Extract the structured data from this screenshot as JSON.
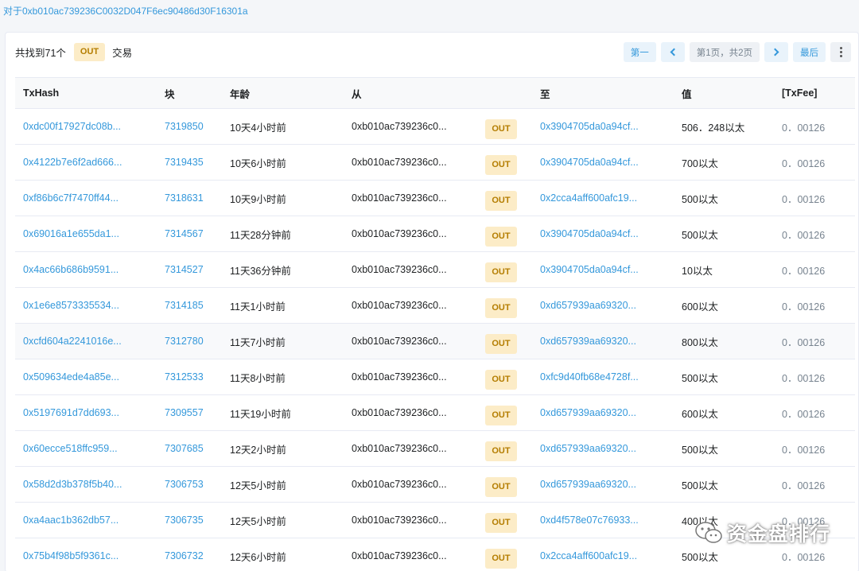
{
  "filter_text": "对于0xb010ac739236C0032D047F6ec90486d30F16301a",
  "summary": {
    "prefix": "共找到71个",
    "badge": "OUT",
    "suffix": "交易"
  },
  "pager": {
    "first": "第一",
    "info": "第1页，共2页",
    "last": "最后"
  },
  "columns": [
    "TxHash",
    "块",
    "年龄",
    "从",
    "",
    "至",
    "值",
    "[TxFee]"
  ],
  "rows": [
    {
      "hash": "0xdc00f17927dc08b...",
      "block": "7319850",
      "age": "10天4小时前",
      "from": "0xb010ac739236c0...",
      "dir": "OUT",
      "to": "0x3904705da0a94cf...",
      "value": "506．248以太",
      "fee": "0．00126"
    },
    {
      "hash": "0x4122b7e6f2ad666...",
      "block": "7319435",
      "age": "10天6小时前",
      "from": "0xb010ac739236c0...",
      "dir": "OUT",
      "to": "0x3904705da0a94cf...",
      "value": "700以太",
      "fee": "0．00126"
    },
    {
      "hash": "0xf86b6c7f7470ff44...",
      "block": "7318631",
      "age": "10天9小时前",
      "from": "0xb010ac739236c0...",
      "dir": "OUT",
      "to": "0x2cca4aff600afc19...",
      "value": "500以太",
      "fee": "0．00126"
    },
    {
      "hash": "0x69016a1e655da1...",
      "block": "7314567",
      "age": "11天28分钟前",
      "from": "0xb010ac739236c0...",
      "dir": "OUT",
      "to": "0x3904705da0a94cf...",
      "value": "500以太",
      "fee": "0．00126"
    },
    {
      "hash": "0x4ac66b686b9591...",
      "block": "7314527",
      "age": "11天36分钟前",
      "from": "0xb010ac739236c0...",
      "dir": "OUT",
      "to": "0x3904705da0a94cf...",
      "value": "10以太",
      "fee": "0．00126"
    },
    {
      "hash": "0x1e6e8573335534...",
      "block": "7314185",
      "age": "11天1小时前",
      "from": "0xb010ac739236c0...",
      "dir": "OUT",
      "to": "0xd657939aa69320...",
      "value": "600以太",
      "fee": "0．00126"
    },
    {
      "hash": "0xcfd604a2241016e...",
      "block": "7312780",
      "age": "11天7小时前",
      "from": "0xb010ac739236c0...",
      "dir": "OUT",
      "to": "0xd657939aa69320...",
      "value": "800以太",
      "fee": "0．00126"
    },
    {
      "hash": "0x509634ede4a85e...",
      "block": "7312533",
      "age": "11天8小时前",
      "from": "0xb010ac739236c0...",
      "dir": "OUT",
      "to": "0xfc9d40fb68e4728f...",
      "value": "500以太",
      "fee": "0．00126"
    },
    {
      "hash": "0x5197691d7dd693...",
      "block": "7309557",
      "age": "11天19小时前",
      "from": "0xb010ac739236c0...",
      "dir": "OUT",
      "to": "0xd657939aa69320...",
      "value": "600以太",
      "fee": "0．00126"
    },
    {
      "hash": "0x60ecce518ffc959...",
      "block": "7307685",
      "age": "12天2小时前",
      "from": "0xb010ac739236c0...",
      "dir": "OUT",
      "to": "0xd657939aa69320...",
      "value": "500以太",
      "fee": "0．00126"
    },
    {
      "hash": "0x58d2d3b378f5b40...",
      "block": "7306753",
      "age": "12天5小时前",
      "from": "0xb010ac739236c0...",
      "dir": "OUT",
      "to": "0xd657939aa69320...",
      "value": "500以太",
      "fee": "0．00126"
    },
    {
      "hash": "0xa4aac1b362db57...",
      "block": "7306735",
      "age": "12天5小时前",
      "from": "0xb010ac739236c0...",
      "dir": "OUT",
      "to": "0xd4f578e07c76933...",
      "value": "400以太",
      "fee": "0．00126"
    },
    {
      "hash": "0x75b4f98b5f9361c...",
      "block": "7306732",
      "age": "12天6小时前",
      "from": "0xb010ac739236c0...",
      "dir": "OUT",
      "to": "0x2cca4aff600afc19...",
      "value": "500以太",
      "fee": "0．00126"
    }
  ],
  "watermark": "资金盘排行",
  "colors": {
    "link": "#3498db",
    "badge_bg": "#fcecc7",
    "badge_text": "#b47d00"
  },
  "icons": {
    "prev": "chevron-left-icon",
    "next": "chevron-right-icon",
    "more": "more-vertical-icon",
    "watermark": "wechat-icon"
  }
}
